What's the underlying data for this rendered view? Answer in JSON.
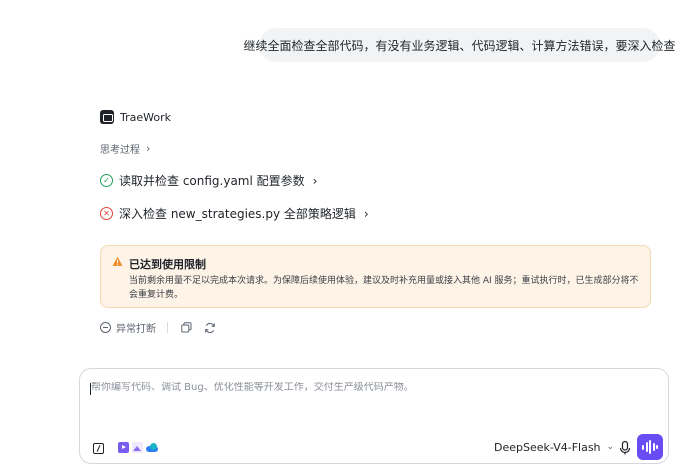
{
  "conversation": {
    "user_message": "继续全面检查全部代码，有没有业务逻辑、代码逻辑、计算方法错误，要深入检查"
  },
  "agent": {
    "name": "TraeWork",
    "thinking_label": "思考过程",
    "steps": [
      {
        "status": "success",
        "label": "读取并检查 config.yaml 配置参数"
      },
      {
        "status": "error",
        "label": "深入检查 new_strategies.py 全部策略逻辑"
      }
    ]
  },
  "warning": {
    "title": "已达到使用限制",
    "body": "当前剩余用量不足以完成本次请求。为保障后续使用体验，建议及时补充用量或接入其他 AI 服务；重试执行时，已生成部分将不会重复计费。"
  },
  "actions": {
    "abort_label": "异常打断"
  },
  "composer": {
    "placeholder": "帮你编写代码、调试 Bug、优化性能等开发工作，交付生产级代码产物。",
    "model": "DeepSeek-V4-Flash"
  },
  "colors": {
    "success": "#22a05a",
    "error": "#e0433c",
    "warning_bg": "#fdf3e7",
    "warning_icon": "#f08a24",
    "accent": "#6a4cf5"
  },
  "icons": {
    "agent_logo": "terminal-box-icon",
    "warning": "warning-triangle-icon",
    "copy": "copy-icon",
    "retry": "refresh-icon",
    "mic": "microphone-icon",
    "voice": "waveform-icon"
  }
}
